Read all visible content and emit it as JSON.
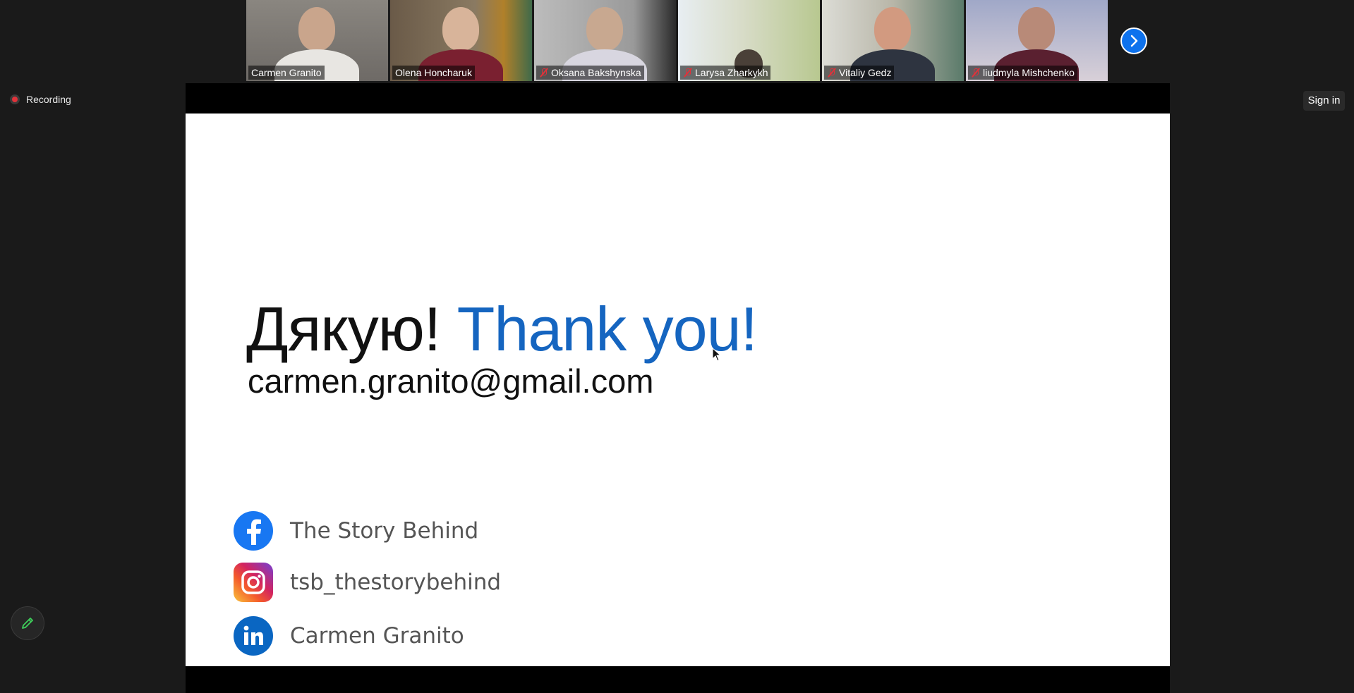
{
  "participants": [
    {
      "name": "Carmen Granito",
      "muted": false,
      "active": false
    },
    {
      "name": "Olena Honcharuk",
      "muted": false,
      "active": true
    },
    {
      "name": "Oksana Bakshynska",
      "muted": true,
      "active": false
    },
    {
      "name": "Larysa Zharkykh",
      "muted": true,
      "active": false
    },
    {
      "name": "Vitaliy Gedz",
      "muted": true,
      "active": false
    },
    {
      "name": "liudmyla Mishchenko",
      "muted": true,
      "active": false
    }
  ],
  "recording": {
    "label": "Recording"
  },
  "header": {
    "signin_label": "Sign in"
  },
  "slide": {
    "headline_ua": "Дякую!",
    "headline_en": "Thank you!",
    "email": "carmen.granito@gmail.com",
    "social": {
      "facebook": "The Story Behind",
      "instagram": "tsb_thestorybehind",
      "linkedin": "Carmen Granito"
    }
  },
  "colors": {
    "accent": "#0e72ed",
    "headline_en": "#1565c0",
    "record": "#e0323a"
  }
}
